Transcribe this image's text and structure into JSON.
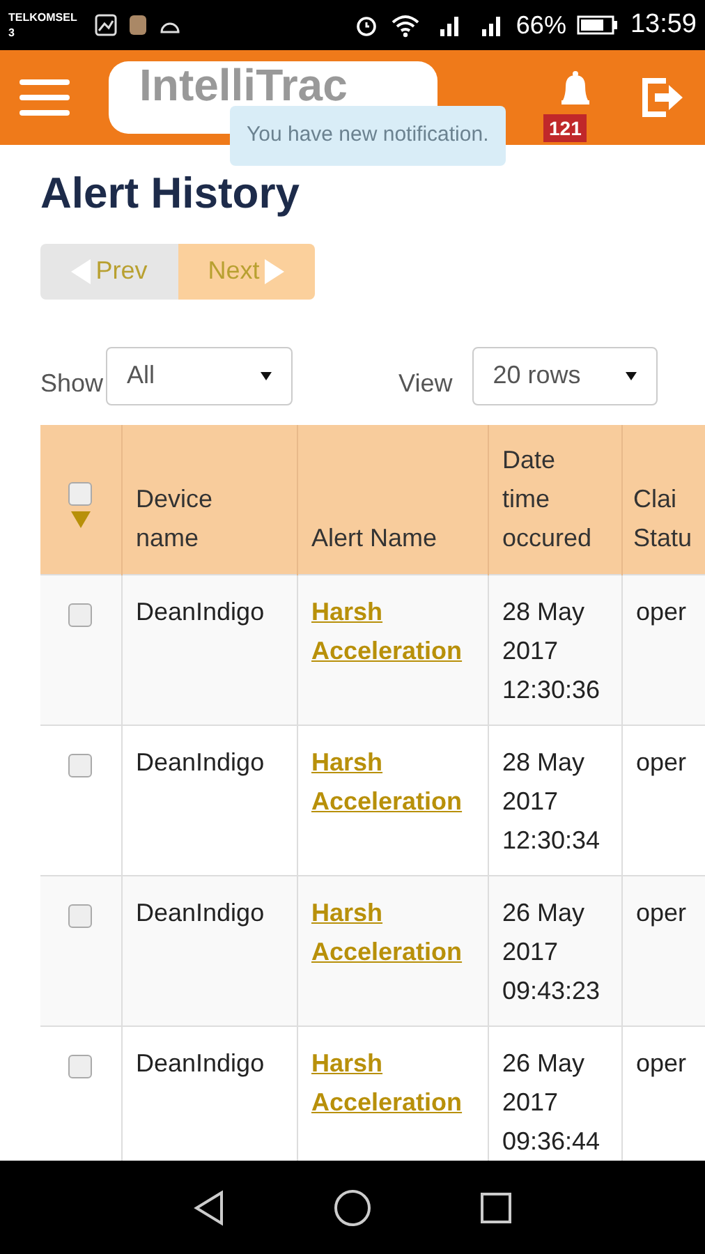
{
  "status_bar": {
    "carrier": "TELKOMSEL 3",
    "battery": "66%",
    "time": "13:59"
  },
  "header": {
    "logo": "IntelliTrac",
    "notification": "You have new notification.",
    "badge": "121"
  },
  "title": "Alert History",
  "pager": [
    {
      "label": "Prev",
      "selected": false
    },
    {
      "label": "Next",
      "selected": true
    }
  ],
  "filters": [
    {
      "label": "Show",
      "value": "All"
    },
    {
      "label": "View",
      "value": "20 rows"
    }
  ],
  "table": {
    "select_all": {
      "checked": false
    },
    "columns": [
      "Device name",
      "Alert Name",
      "Date time occured",
      "Clai Statu"
    ],
    "rows": [
      {
        "checked": false,
        "device": "DeanIndigo",
        "alert": "Harsh Acceleration",
        "date": "28 May 2017 12:30:36",
        "status": "oper"
      },
      {
        "checked": false,
        "device": "DeanIndigo",
        "alert": "Harsh Acceleration",
        "date": "28 May 2017 12:30:34",
        "status": "oper"
      },
      {
        "checked": false,
        "device": "DeanIndigo",
        "alert": "Harsh Acceleration",
        "date": "26 May 2017 09:43:23",
        "status": "oper"
      },
      {
        "checked": false,
        "device": "DeanIndigo",
        "alert": "Harsh Acceleration",
        "date": "26 May 2017 09:36:44",
        "status": "oper"
      }
    ]
  }
}
